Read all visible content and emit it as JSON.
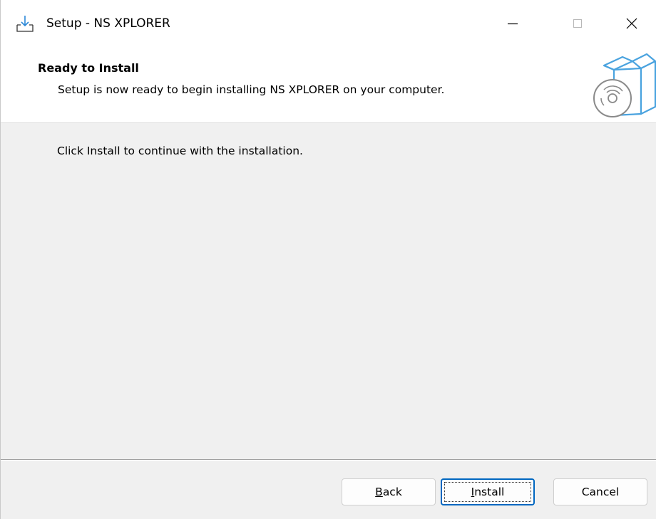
{
  "window": {
    "title": "Setup - NS XPLORER",
    "icons": {
      "app": "installer-download-icon",
      "minimize": "minimize-icon",
      "maximize": "maximize-icon",
      "close": "close-icon"
    }
  },
  "header": {
    "title": "Ready to Install",
    "subtitle": "Setup is now ready to begin installing NS XPLORER on your computer.",
    "graphic_icon": "software-box-cd-icon"
  },
  "body": {
    "instruction": "Click Install to continue with the installation."
  },
  "buttons": {
    "back": {
      "first": "B",
      "rest": "ack"
    },
    "install": {
      "first": "I",
      "rest": "nstall"
    },
    "cancel": "Cancel"
  },
  "colors": {
    "accent": "#0067c0",
    "icon_blue": "#4aa3df",
    "window_bg": "#f0f0f0"
  }
}
